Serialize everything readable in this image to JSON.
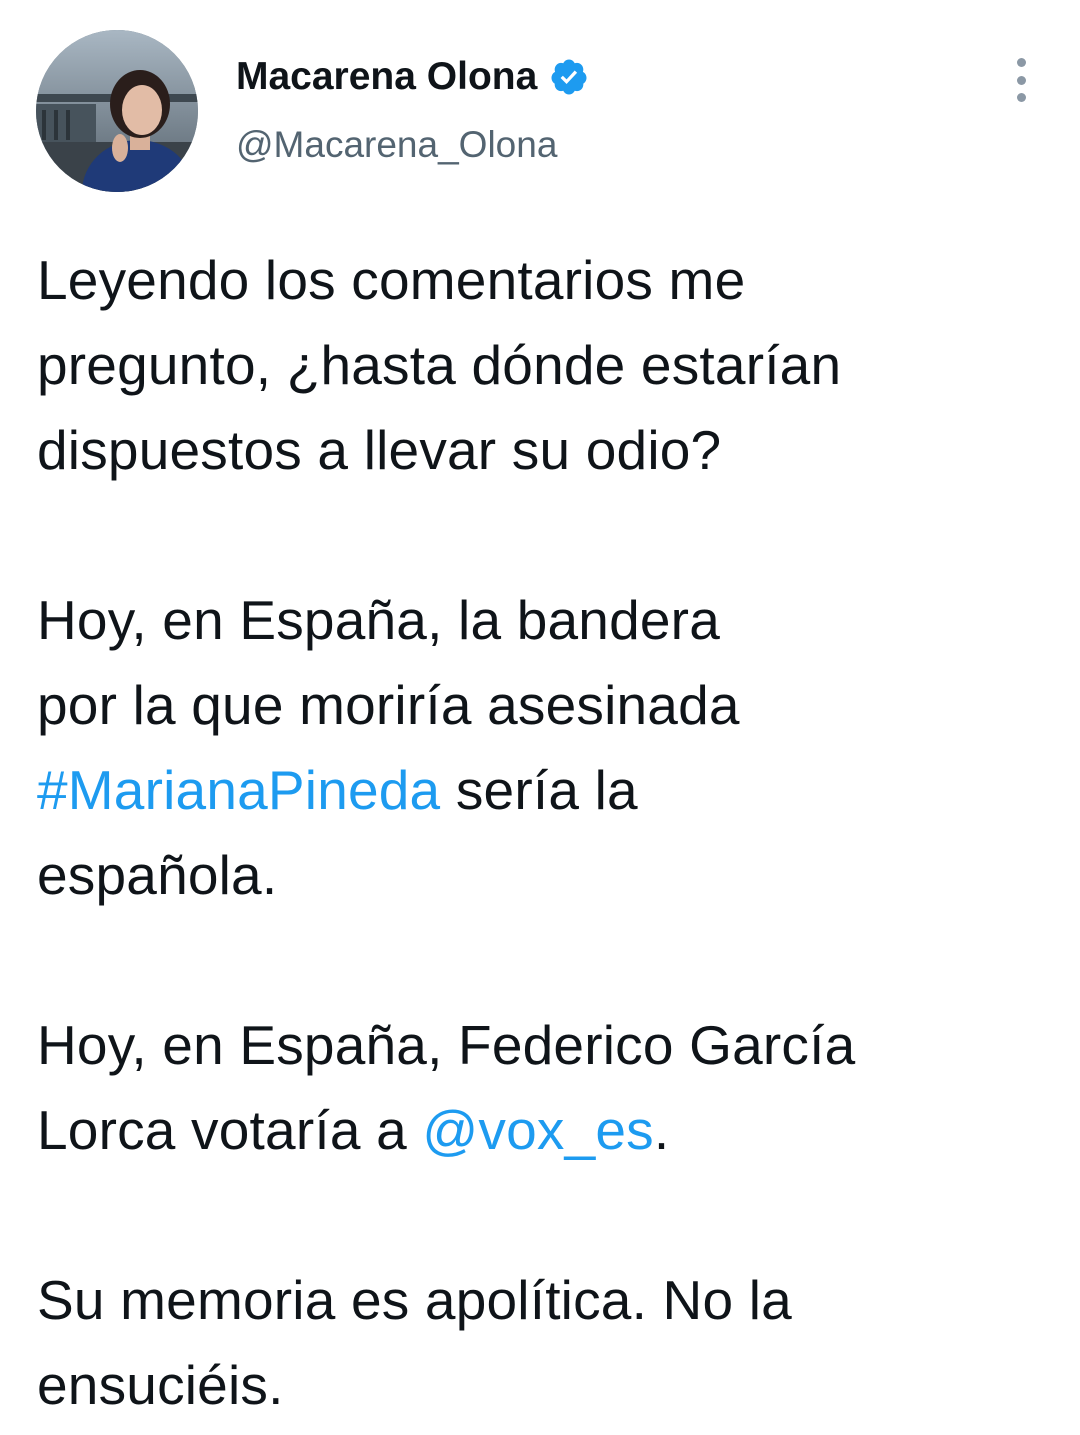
{
  "author": {
    "display_name": "Macarena Olona",
    "handle": "@Macarena_Olona",
    "verified_icon": "verified-badge-icon",
    "avatar_icon": "profile-photo",
    "more_icon": "more-options-icon"
  },
  "tweet": {
    "p1_line1": "Leyendo los comentarios me",
    "p1_line2": "pregunto, ¿hasta dónde estarían",
    "p1_line3": "dispuestos a llevar su odio?",
    "p2_line1": "Hoy, en España, la bandera",
    "p2_line2": "por la que moriría asesinada",
    "p2_hashtag": "#MarianaPineda",
    "p2_line3_rest": " sería la",
    "p2_line4": "española.",
    "p3_line1": "Hoy, en España, Federico García",
    "p3_line2_pre": "Lorca votaría a ",
    "p3_mention": "@vox_es",
    "p3_line2_post": ".",
    "p4_line1": "Su memoria es apolítica. No la",
    "p4_line2": "ensuciéis."
  },
  "colors": {
    "link": "#1d9bf0",
    "text": "#0f1419",
    "secondary": "#536471",
    "verified": "#1d9bf0"
  }
}
